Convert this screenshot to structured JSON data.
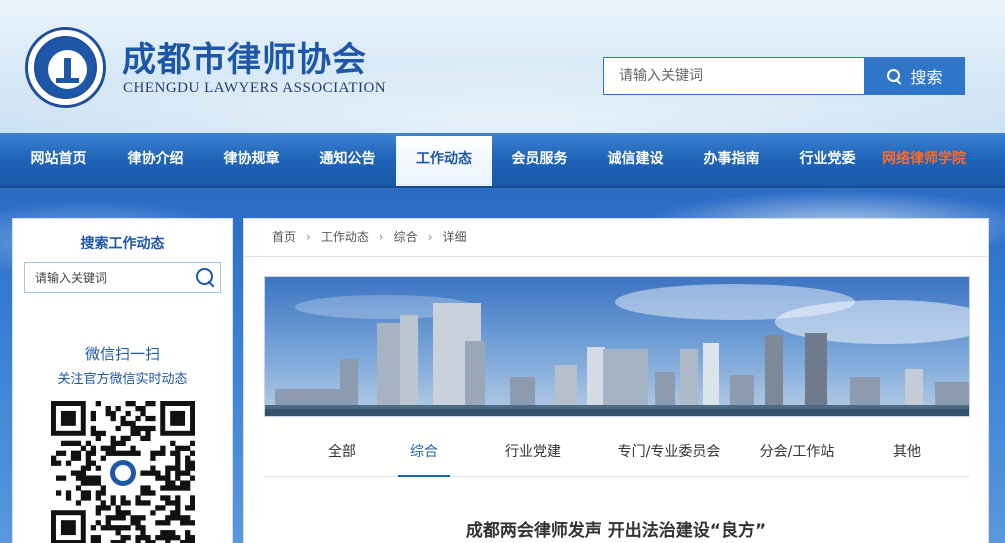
{
  "header": {
    "title": "成都市律师协会",
    "subtitle": "CHENGDU LAWYERS ASSOCIATION",
    "search_placeholder": "请输入关键词",
    "search_button": "搜索"
  },
  "nav": {
    "items": [
      {
        "label": "网站首页",
        "active": false,
        "highlight": false
      },
      {
        "label": "律协介绍",
        "active": false,
        "highlight": false
      },
      {
        "label": "律协规章",
        "active": false,
        "highlight": false
      },
      {
        "label": "通知公告",
        "active": false,
        "highlight": false
      },
      {
        "label": "工作动态",
        "active": true,
        "highlight": false
      },
      {
        "label": "会员服务",
        "active": false,
        "highlight": false
      },
      {
        "label": "诚信建设",
        "active": false,
        "highlight": false
      },
      {
        "label": "办事指南",
        "active": false,
        "highlight": false
      },
      {
        "label": "行业党委",
        "active": false,
        "highlight": false
      },
      {
        "label": "网络律师学院",
        "active": false,
        "highlight": true
      }
    ]
  },
  "sidebar": {
    "search_title": "搜索工作动态",
    "search_placeholder": "请输入关键词",
    "wechat_title": "微信扫一扫",
    "wechat_subtitle": "关注官方微信实时动态"
  },
  "breadcrumb": [
    "首页",
    "工作动态",
    "综合",
    "详细"
  ],
  "tabs": [
    {
      "label": "全部",
      "active": false
    },
    {
      "label": "综合",
      "active": true
    },
    {
      "label": "行业党建",
      "active": false
    },
    {
      "label": "专门/专业委员会",
      "active": false
    },
    {
      "label": "分会/工作站",
      "active": false
    },
    {
      "label": "其他",
      "active": false
    }
  ],
  "article": {
    "title": "成都两会律师发声 开出法治建设“良方”"
  },
  "colors": {
    "brand_blue": "#1e56a8",
    "nav_blue": "#1f63b8",
    "highlight_orange": "#ff6a2a"
  },
  "icons": {
    "logo": "association-emblem",
    "search": "search-icon",
    "breadcrumb_separator": "chevron-right-icon",
    "qr": "wechat-qr-code"
  }
}
